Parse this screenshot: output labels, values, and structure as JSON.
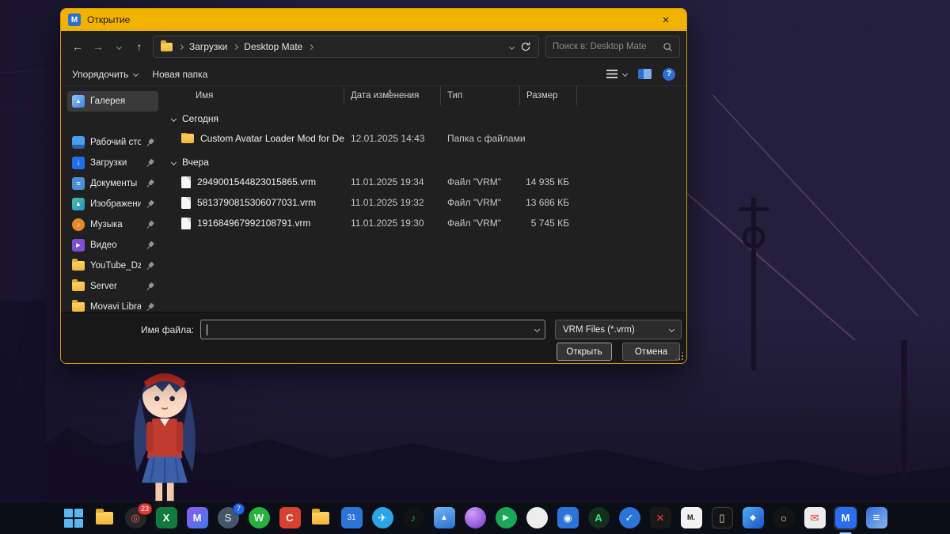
{
  "colors": {
    "titlebar": "#f2b200",
    "dialog_bg": "#202020",
    "accent_blue": "#2b6fd4",
    "taskbar_bg": "#0c0f16"
  },
  "window": {
    "title": "Открытие",
    "close_glyph": "×",
    "app_icon_letter": "M"
  },
  "nav": {
    "back": "←",
    "forward": "→",
    "up": "↑",
    "breadcrumb": {
      "items": [
        "Загрузки",
        "Desktop Mate"
      ]
    },
    "search_placeholder": "Поиск в: Desktop Mate"
  },
  "toolbar": {
    "organize": "Упорядочить",
    "new_folder": "Новая папка",
    "help": "?"
  },
  "sidebar": {
    "items": [
      {
        "label": "Галерея"
      },
      {
        "label": "Рабочий сто"
      },
      {
        "label": "Загрузки"
      },
      {
        "label": "Документы"
      },
      {
        "label": "Изображени"
      },
      {
        "label": "Музыка"
      },
      {
        "label": "Видео"
      },
      {
        "label": "YouTube_Dze"
      },
      {
        "label": "Server"
      },
      {
        "label": "Movavi Libra"
      }
    ]
  },
  "filelist": {
    "columns": [
      "Имя",
      "Дата изменения",
      "Тип",
      "Размер"
    ],
    "sort_glyph": "∧",
    "groups": [
      {
        "label": "Сегодня",
        "items": [
          {
            "name": "Custom Avatar Loader Mod for Desktop ...",
            "date": "12.01.2025 14:43",
            "type": "Папка с файлами",
            "size": ""
          }
        ]
      },
      {
        "label": "Вчера",
        "items": [
          {
            "name": "2949001544823015865.vrm",
            "date": "11.01.2025 19:34",
            "type": "Файл \"VRM\"",
            "size": "14 935 КБ"
          },
          {
            "name": "5813790815306077031.vrm",
            "date": "11.01.2025 19:32",
            "type": "Файл \"VRM\"",
            "size": "13 686 КБ"
          },
          {
            "name": "191684967992108791.vrm",
            "date": "11.01.2025 19:30",
            "type": "Файл \"VRM\"",
            "size": "5 745 КБ"
          }
        ]
      }
    ]
  },
  "footer": {
    "filename_label": "Имя файла:",
    "filename_value": "",
    "filetype_value": "VRM Files (*.vrm)",
    "open_label": "Открыть",
    "cancel_label": "Отмена"
  },
  "taskbar": {
    "icons": [
      {
        "glyph": "",
        "style": ""
      },
      {
        "glyph": "",
        "style": ""
      },
      {
        "glyph": "◎",
        "style": "background:#262626;color:#ff6159;border-radius:50%",
        "badge": "23"
      },
      {
        "glyph": "X",
        "style": "background:#0f7b3e;color:#fff;font-weight:bold"
      },
      {
        "glyph": "M",
        "style": "background:linear-gradient(135deg,#8a5cf0,#3f7ae8);color:#fff;font-weight:bold"
      },
      {
        "glyph": "S",
        "style": "background:#45566b;color:#e8f0f8;border-radius:50%",
        "badge": "7"
      },
      {
        "glyph": "W",
        "style": "background:#25b33e;color:#fff;border-radius:50%;font-weight:bold"
      },
      {
        "glyph": "C",
        "style": "background:#d8402f;color:#fff;font-weight:bold"
      },
      {
        "glyph": "",
        "style": ""
      },
      {
        "glyph": "31",
        "style": "background:#2b74d9;color:#fff;font-size:10px"
      },
      {
        "glyph": "✈",
        "style": "background:#2aa5e5;color:#fff;border-radius:50%"
      },
      {
        "glyph": "♪",
        "style": "background:#121212;color:#1db954;border-radius:50%"
      },
      {
        "glyph": "▲",
        "style": "background:linear-gradient(160deg,#6fb6f0,#2e6fd0);color:#fff;font-size:10px"
      },
      {
        "glyph": "",
        "style": "background:radial-gradient(circle at 35% 30%,#d0a0f8,#6f35c8);border-radius:50%"
      },
      {
        "glyph": "▶",
        "style": "background:#18a85a;color:#fff;border-radius:50%;font-size:10px"
      },
      {
        "glyph": "",
        "style": "background:#ededed;border-radius:50%"
      },
      {
        "glyph": "◉",
        "style": "background:#2b74d9;color:#fff"
      },
      {
        "glyph": "A",
        "style": "background:#12301c;color:#3ddc84;border-radius:50%;font-weight:bold"
      },
      {
        "glyph": "✓",
        "style": "background:#2b74d9;color:#fff;border-radius:50%"
      },
      {
        "glyph": "×",
        "style": "background:#181818;color:#ff4040;font-size:17px"
      },
      {
        "glyph": "M.",
        "style": "background:#f2f2f2;color:#151515;font-size:9px;font-weight:bold"
      },
      {
        "glyph": "▯",
        "style": "background:#141414;color:#d8d8d8;border:1px solid #3a3a3a"
      },
      {
        "glyph": "◆",
        "style": "background:linear-gradient(135deg,#49b0f5,#2050c8);color:#fff;font-size:10px"
      },
      {
        "glyph": "○",
        "style": "background:#141414;color:#f0f0f0;border-radius:50%;font-size:14px"
      },
      {
        "glyph": "✉",
        "style": "background:#ececec;color:#e23b2e"
      },
      {
        "glyph": "M",
        "style": "background:#2b6cf0;color:#fff;font-weight:bold",
        "active": true
      },
      {
        "glyph": "≡",
        "style": "background:linear-gradient(135deg,#2f6fd6,#8ab6f0);color:#fff;font-size:15px;font-weight:bold"
      }
    ]
  }
}
